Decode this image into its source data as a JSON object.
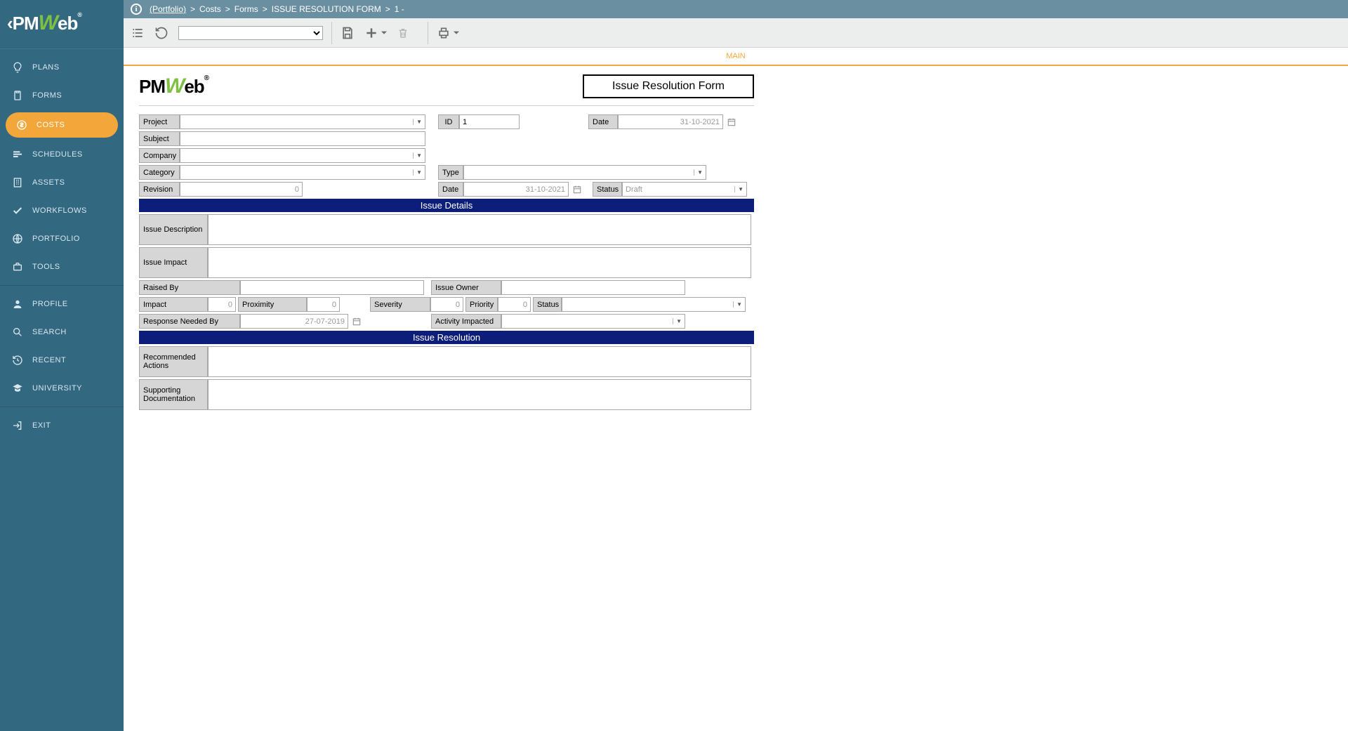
{
  "brand": {
    "name": "PMWeb",
    "registered": "®"
  },
  "sidebar": {
    "items": [
      {
        "label": "PLANS"
      },
      {
        "label": "FORMS"
      },
      {
        "label": "COSTS"
      },
      {
        "label": "SCHEDULES"
      },
      {
        "label": "ASSETS"
      },
      {
        "label": "WORKFLOWS"
      },
      {
        "label": "PORTFOLIO"
      },
      {
        "label": "TOOLS"
      }
    ],
    "bottom_items": [
      {
        "label": "PROFILE"
      },
      {
        "label": "SEARCH"
      },
      {
        "label": "RECENT"
      },
      {
        "label": "UNIVERSITY"
      }
    ],
    "exit": {
      "label": "EXIT"
    }
  },
  "breadcrumb": {
    "portfolio": "(Portfolio)",
    "crumbs": [
      "Costs",
      "Forms",
      "ISSUE RESOLUTION FORM",
      "1 -"
    ],
    "sep": ">"
  },
  "tabs": {
    "main": "MAIN"
  },
  "form": {
    "title": "Issue Resolution Form",
    "project_lbl": "Project",
    "id_lbl": "ID",
    "id_val": "1",
    "date_lbl": "Date",
    "date_val": "31-10-2021",
    "subject_lbl": "Subject",
    "company_lbl": "Company",
    "category_lbl": "Category",
    "type_lbl": "Type",
    "revision_lbl": "Revision",
    "revision_val": "0",
    "rev_date_lbl": "Date",
    "rev_date_val": "31-10-2021",
    "status_lbl": "Status",
    "status_val": "Draft",
    "section_details": "Issue Details",
    "issue_desc_lbl": "Issue Description",
    "issue_impact_lbl": "Issue Impact",
    "raised_by_lbl": "Raised By",
    "issue_owner_lbl": "Issue Owner",
    "impact_lbl": "Impact",
    "impact_val": "0",
    "proximity_lbl": "Proximity",
    "proximity_val": "0",
    "severity_lbl": "Severity",
    "severity_val": "0",
    "priority_lbl": "Priority",
    "priority_val": "0",
    "status2_lbl": "Status",
    "response_needed_lbl": "Response Needed By",
    "response_needed_val": "27-07-2019",
    "activity_impacted_lbl": "Activity Impacted",
    "section_resolution": "Issue Resolution",
    "rec_actions_lbl": "Recommended Actions",
    "supp_doc_lbl": "Supporting Documentation"
  }
}
